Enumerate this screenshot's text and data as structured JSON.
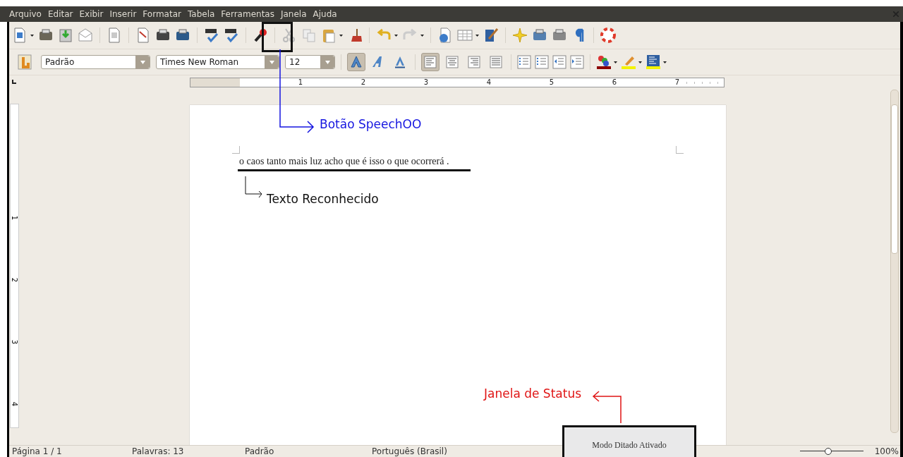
{
  "menu_bar": [
    "Arquivo",
    "Editar",
    "Exibir",
    "Inserir",
    "Formatar",
    "Tabela",
    "Ferramentas",
    "Janela",
    "Ajuda"
  ],
  "formatting_toolbar": {
    "style": "Padrão",
    "font": "Times New Roman",
    "size": "12",
    "text_buttons": [
      {
        "kind": "bold",
        "selected": true
      },
      {
        "kind": "italic",
        "selected": false
      },
      {
        "kind": "underline",
        "selected": false
      }
    ],
    "align_buttons": [
      {
        "kind": "left",
        "selected": true
      },
      {
        "kind": "center",
        "selected": false
      },
      {
        "kind": "right",
        "selected": false
      },
      {
        "kind": "justify",
        "selected": false
      }
    ]
  },
  "ruler": [
    "1",
    "2",
    "3",
    "4",
    "5",
    "6",
    "7"
  ],
  "vertical_ruler": [
    "1",
    "2",
    "3",
    "4"
  ],
  "document": {
    "text": "o caos tanto mais luz acho que é isso o que ocorrerá  ."
  },
  "annotations": [
    {
      "kind": "button",
      "text": "Botão SpeechOO",
      "color": "#1515e0"
    },
    {
      "kind": "text",
      "text": "Texto Reconhecido",
      "color": "#111111"
    },
    {
      "kind": "status",
      "text": "Janela de Status",
      "color": "#e01515"
    }
  ],
  "status_window": {
    "text": "Modo Ditado Ativado"
  },
  "status_bar": {
    "page": "Página 1 / 1",
    "words": "Palavras: 13",
    "style": "Padrão",
    "language": "Português (Brasil)",
    "zoom": "100%",
    "zoom_slider": {
      "level": 0.45
    }
  }
}
